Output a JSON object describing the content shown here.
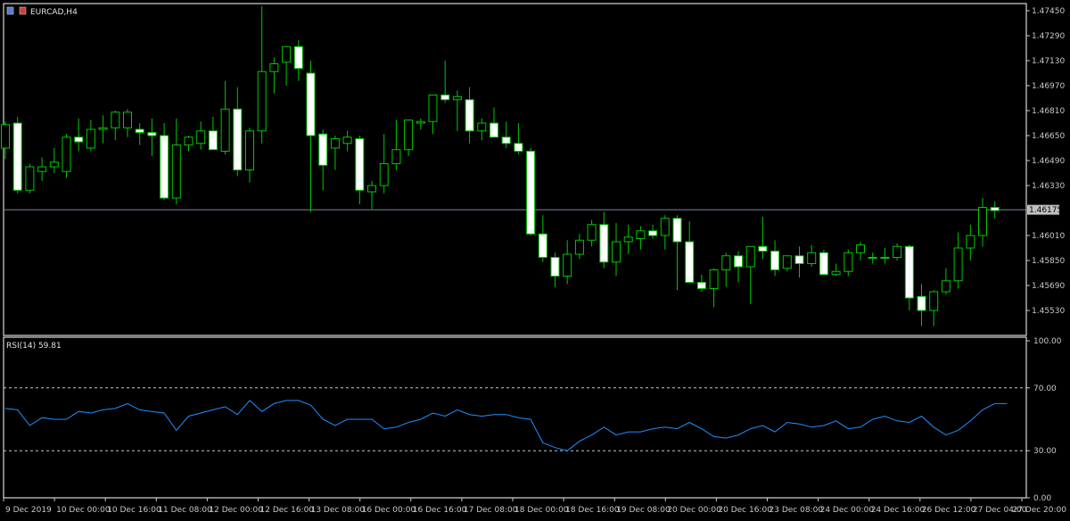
{
  "window": {
    "symbol_label": "EURCAD,H4"
  },
  "chart_data": [
    {
      "type": "candlestick",
      "symbol": "EURCAD",
      "timeframe": "H4",
      "ylim": [
        1.4545,
        1.475
      ],
      "y_ticks": [
        "1.47450",
        "1.47290",
        "1.47130",
        "1.46970",
        "1.46810",
        "1.46650",
        "1.46490",
        "1.46330",
        "1.46010",
        "1.45850",
        "1.45690",
        "1.45530"
      ],
      "current_price": "1.46175",
      "colors": {
        "bull_fill": "#000000",
        "bear_fill": "#ffffff",
        "wick": "#00c800",
        "current_line": "#7a8a9a",
        "current_label_bg": "#c0c0c0",
        "grid": "#ffffff"
      },
      "ohlc": [
        [
          1.4657,
          1.4674,
          1.465,
          1.4672
        ],
        [
          1.4673,
          1.4677,
          1.4628,
          1.463
        ],
        [
          1.463,
          1.4647,
          1.4628,
          1.4645
        ],
        [
          1.4642,
          1.4651,
          1.4636,
          1.4645
        ],
        [
          1.4645,
          1.4657,
          1.4641,
          1.4648
        ],
        [
          1.4642,
          1.4666,
          1.4638,
          1.4664
        ],
        [
          1.4664,
          1.4676,
          1.4655,
          1.4661
        ],
        [
          1.4657,
          1.4675,
          1.4655,
          1.4669
        ],
        [
          1.4669,
          1.4678,
          1.466,
          1.467
        ],
        [
          1.467,
          1.4681,
          1.4662,
          1.468
        ],
        [
          1.467,
          1.4682,
          1.4664,
          1.468
        ],
        [
          1.4669,
          1.4673,
          1.4659,
          1.4667
        ],
        [
          1.4667,
          1.4676,
          1.4652,
          1.4665
        ],
        [
          1.4665,
          1.4673,
          1.4624,
          1.4625
        ],
        [
          1.4625,
          1.4676,
          1.4621,
          1.4659
        ],
        [
          1.4659,
          1.4665,
          1.4655,
          1.4664
        ],
        [
          1.466,
          1.4674,
          1.4656,
          1.4668
        ],
        [
          1.4668,
          1.4677,
          1.4657,
          1.4656
        ],
        [
          1.4655,
          1.47,
          1.4653,
          1.4682
        ],
        [
          1.4682,
          1.4696,
          1.4639,
          1.4643
        ],
        [
          1.4643,
          1.467,
          1.4635,
          1.4668
        ],
        [
          1.4668,
          1.4748,
          1.466,
          1.4706
        ],
        [
          1.4706,
          1.4715,
          1.4692,
          1.4711
        ],
        [
          1.4712,
          1.4722,
          1.4697,
          1.4722
        ],
        [
          1.4722,
          1.4726,
          1.47,
          1.4708
        ],
        [
          1.4705,
          1.4713,
          1.4616,
          1.4665
        ],
        [
          1.4666,
          1.4669,
          1.463,
          1.4646
        ],
        [
          1.4657,
          1.4665,
          1.4643,
          1.4663
        ],
        [
          1.466,
          1.4668,
          1.4655,
          1.4664
        ],
        [
          1.4663,
          1.4665,
          1.4621,
          1.463
        ],
        [
          1.4629,
          1.4636,
          1.4618,
          1.4633
        ],
        [
          1.4633,
          1.4666,
          1.4628,
          1.4647
        ],
        [
          1.4647,
          1.4675,
          1.4643,
          1.4656
        ],
        [
          1.4656,
          1.4675,
          1.4652,
          1.4675
        ],
        [
          1.4673,
          1.4676,
          1.4669,
          1.4674
        ],
        [
          1.4674,
          1.469,
          1.4666,
          1.4691
        ],
        [
          1.4691,
          1.4713,
          1.4686,
          1.4688
        ],
        [
          1.4688,
          1.4694,
          1.4668,
          1.469
        ],
        [
          1.4688,
          1.4696,
          1.466,
          1.4668
        ],
        [
          1.4668,
          1.4676,
          1.4662,
          1.4673
        ],
        [
          1.4673,
          1.4683,
          1.4665,
          1.4664
        ],
        [
          1.4664,
          1.4674,
          1.4657,
          1.466
        ],
        [
          1.466,
          1.4673,
          1.4653,
          1.4655
        ],
        [
          1.4655,
          1.4657,
          1.4601,
          1.4602
        ],
        [
          1.4602,
          1.4614,
          1.4584,
          1.4587
        ],
        [
          1.4587,
          1.459,
          1.4568,
          1.4575
        ],
        [
          1.4575,
          1.4598,
          1.457,
          1.4589
        ],
        [
          1.4589,
          1.4602,
          1.4586,
          1.4598
        ],
        [
          1.4598,
          1.4611,
          1.4594,
          1.4608
        ],
        [
          1.4608,
          1.4616,
          1.458,
          1.4584
        ],
        [
          1.4584,
          1.4609,
          1.4575,
          1.4597
        ],
        [
          1.4597,
          1.4608,
          1.4589,
          1.46
        ],
        [
          1.4599,
          1.4607,
          1.4592,
          1.4604
        ],
        [
          1.4604,
          1.4608,
          1.4599,
          1.4601
        ],
        [
          1.4601,
          1.4614,
          1.4592,
          1.4612
        ],
        [
          1.4612,
          1.4614,
          1.4566,
          1.4597
        ],
        [
          1.4597,
          1.461,
          1.4572,
          1.4571
        ],
        [
          1.4571,
          1.4576,
          1.4565,
          1.4567
        ],
        [
          1.4567,
          1.458,
          1.4555,
          1.4579
        ],
        [
          1.4579,
          1.459,
          1.4568,
          1.4588
        ],
        [
          1.4588,
          1.4591,
          1.4571,
          1.4581
        ],
        [
          1.4581,
          1.4593,
          1.4557,
          1.4594
        ],
        [
          1.4594,
          1.4613,
          1.4586,
          1.4591
        ],
        [
          1.4591,
          1.4598,
          1.4575,
          1.4579
        ],
        [
          1.458,
          1.4588,
          1.4578,
          1.4588
        ],
        [
          1.4588,
          1.4594,
          1.4574,
          1.4583
        ],
        [
          1.4583,
          1.4595,
          1.4581,
          1.459
        ],
        [
          1.459,
          1.4592,
          1.4577,
          1.4576
        ],
        [
          1.4576,
          1.4583,
          1.4575,
          1.4578
        ],
        [
          1.4578,
          1.4592,
          1.4575,
          1.459
        ],
        [
          1.459,
          1.4597,
          1.4585,
          1.4595
        ],
        [
          1.4587,
          1.459,
          1.4583,
          1.4587
        ],
        [
          1.4587,
          1.4593,
          1.4583,
          1.4587
        ],
        [
          1.4587,
          1.4596,
          1.4585,
          1.4594
        ],
        [
          1.4594,
          1.4595,
          1.4553,
          1.4561
        ],
        [
          1.4562,
          1.457,
          1.4543,
          1.4553
        ],
        [
          1.4553,
          1.4566,
          1.4543,
          1.4565
        ],
        [
          1.4565,
          1.458,
          1.4563,
          1.4572
        ],
        [
          1.4572,
          1.4603,
          1.4567,
          1.4593
        ],
        [
          1.4593,
          1.4608,
          1.4585,
          1.4601
        ],
        [
          1.4601,
          1.4625,
          1.4594,
          1.4619
        ],
        [
          1.4619,
          1.4623,
          1.4612,
          1.4617
        ]
      ]
    },
    {
      "type": "line",
      "label": "RSI(14) 59.81",
      "ylim": [
        0,
        100
      ],
      "y_ticks": [
        "100.00",
        "70.00",
        "30.00",
        "0.00"
      ],
      "levels": [
        70,
        30
      ],
      "color": "#1e90ff",
      "values": [
        57,
        56,
        46,
        51,
        50,
        50,
        55,
        54,
        56,
        57,
        60,
        56,
        55,
        54,
        43,
        52,
        54,
        56,
        58,
        53,
        62,
        55,
        60,
        62,
        62,
        59,
        50,
        46,
        50,
        50,
        50,
        44,
        45,
        48,
        50,
        54,
        52,
        56,
        53,
        52,
        53,
        53,
        51,
        50,
        35,
        32,
        30,
        36,
        40,
        45,
        40,
        42,
        42,
        44,
        45,
        44,
        48,
        44,
        39,
        38,
        40,
        44,
        46,
        42,
        48,
        47,
        45,
        46,
        49,
        44,
        45,
        50,
        52,
        49,
        48,
        52,
        45,
        40,
        43,
        49,
        56,
        60,
        60
      ]
    }
  ],
  "time_axis": [
    "9 Dec 2019",
    "10 Dec 00:00",
    "10 Dec 16:00",
    "11 Dec 08:00",
    "12 Dec 00:00",
    "12 Dec 16:00",
    "13 Dec 08:00",
    "16 Dec 00:00",
    "16 Dec 16:00",
    "17 Dec 08:00",
    "18 Dec 00:00",
    "18 Dec 16:00",
    "19 Dec 08:00",
    "20 Dec 00:00",
    "20 Dec 16:00",
    "23 Dec 08:00",
    "24 Dec 00:00",
    "24 Dec 16:00",
    "26 Dec 12:00",
    "27 Dec 04:00",
    "27 Dec 20:00"
  ]
}
